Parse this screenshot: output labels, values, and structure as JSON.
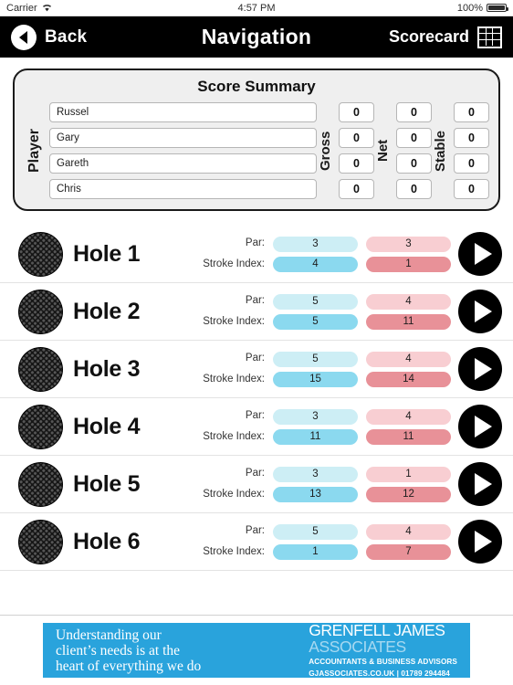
{
  "status_bar": {
    "carrier": "Carrier",
    "wifi_icon": "wifi-icon",
    "time": "4:57 PM",
    "battery_percent": "100%",
    "battery_icon": "battery-full-icon"
  },
  "navbar": {
    "back_label": "Back",
    "back_icon": "back-arrow-icon",
    "title": "Navigation",
    "scorecard_label": "Scorecard",
    "scorecard_icon": "grid-icon"
  },
  "summary": {
    "title": "Score Summary",
    "player_label": "Player",
    "gross_label": "Gross",
    "net_label": "Net",
    "stable_label": "Stable",
    "players": [
      {
        "name": "Russel",
        "gross": "0",
        "net": "0",
        "stable": "0"
      },
      {
        "name": "Gary",
        "gross": "0",
        "net": "0",
        "stable": "0"
      },
      {
        "name": "Gareth",
        "gross": "0",
        "net": "0",
        "stable": "0"
      },
      {
        "name": "Chris",
        "gross": "0",
        "net": "0",
        "stable": "0"
      }
    ]
  },
  "holes_section": {
    "par_label": "Par:",
    "stroke_index_label": "Stroke Index:",
    "ball_icon": "golf-ball-icon",
    "play_icon": "play-arrow-icon",
    "holes": [
      {
        "name": "Hole 1",
        "blue_par": "3",
        "blue_si": "4",
        "red_par": "3",
        "red_si": "1"
      },
      {
        "name": "Hole 2",
        "blue_par": "5",
        "blue_si": "5",
        "red_par": "4",
        "red_si": "11"
      },
      {
        "name": "Hole 3",
        "blue_par": "5",
        "blue_si": "15",
        "red_par": "4",
        "red_si": "14"
      },
      {
        "name": "Hole 4",
        "blue_par": "3",
        "blue_si": "11",
        "red_par": "4",
        "red_si": "11"
      },
      {
        "name": "Hole 5",
        "blue_par": "3",
        "blue_si": "13",
        "red_par": "1",
        "red_si": "12"
      },
      {
        "name": "Hole 6",
        "blue_par": "5",
        "blue_si": "1",
        "red_par": "4",
        "red_si": "7"
      }
    ]
  },
  "ad": {
    "copy_line1": "Understanding our",
    "copy_line2": "client’s needs is at the",
    "copy_line3": "heart of everything we do",
    "brand_line1": "GRENFELL JAMES",
    "brand_line2": "ASSOCIATES",
    "sub_line1": "ACCOUNTANTS & BUSINESS ADVISORS",
    "sub_line2": "GJASSOCIATES.CO.UK  |  01789 294484",
    "background_color": "#29a3dc"
  },
  "colors": {
    "navbar_bg": "#000000",
    "pill_blue_light": "#cdeef5",
    "pill_blue_dark": "#8bd9ef",
    "pill_red_light": "#f8ced2",
    "pill_red_dark": "#e89198",
    "card_bg": "#efefef"
  }
}
